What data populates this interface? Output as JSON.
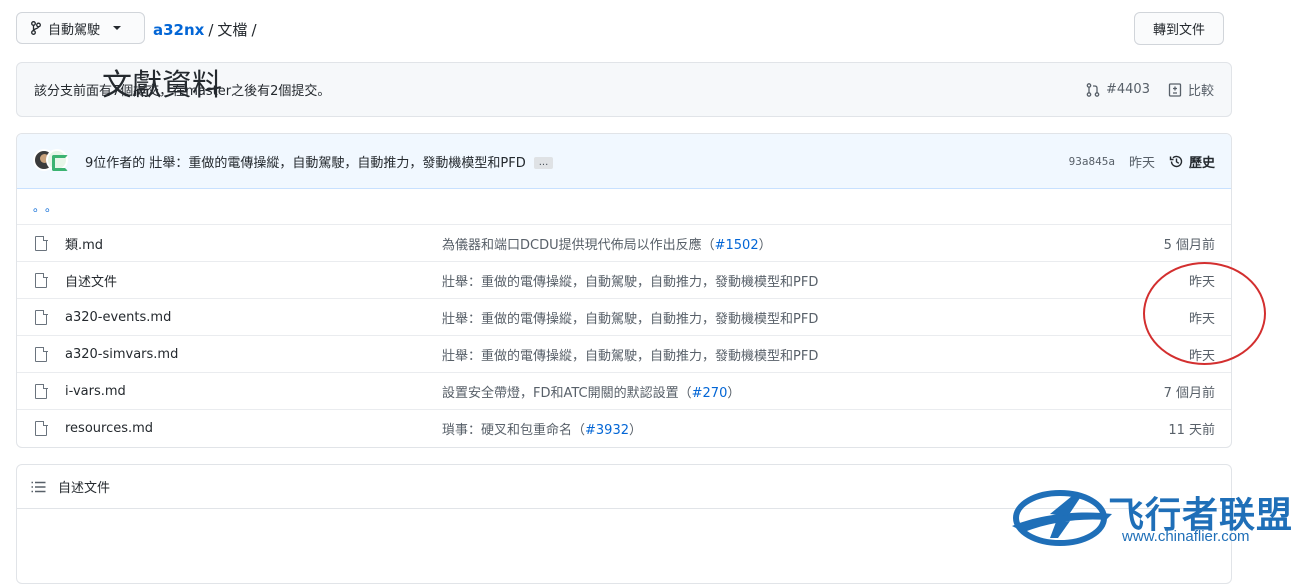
{
  "topbar": {
    "branch_label": "自動駕駛",
    "repo": "a32nx",
    "folder": "文檔",
    "goto_label": "轉到文件"
  },
  "ahead": {
    "message": "該分支前面有7個提交，在master之後有2個提交。",
    "pr_label": "#4403",
    "compare_label": "比較"
  },
  "commit": {
    "message": "9位作者的 壯舉：重做的電傳操縱，自動駕駛，自動推力，發動機模型和PFD",
    "ellipsis": "...",
    "sha": "93a845a",
    "time": "昨天",
    "history_label": "歷史"
  },
  "dots_row": "。。",
  "files": [
    {
      "name": "類.md",
      "msg": "為儀器和端口DCDU提供現代佈局以作出反應（",
      "pr": "#1502",
      "msg_end": "）",
      "age": "5 個月前"
    },
    {
      "name": "自述文件",
      "msg": "壯舉：重做的電傳操縱，自動駕駛，自動推力，發動機模型和PFD",
      "pr": "",
      "msg_end": "",
      "age": "昨天"
    },
    {
      "name": "a320-events.md",
      "msg": "壯舉：重做的電傳操縱，自動駕駛，自動推力，發動機模型和PFD",
      "pr": "",
      "msg_end": "",
      "age": "昨天"
    },
    {
      "name": "a320-simvars.md",
      "msg": "壯舉：重做的電傳操縱，自動駕駛，自動推力，發動機模型和PFD",
      "pr": "",
      "msg_end": "",
      "age": "昨天"
    },
    {
      "name": "i-vars.md",
      "msg": "設置安全帶燈，FD和ATC開關的默認設置（",
      "pr": "#270",
      "msg_end": "）",
      "age": "7 個月前"
    },
    {
      "name": "resources.md",
      "msg": "瑣事：硬叉和包重命名（",
      "pr": "#3932",
      "msg_end": "）",
      "age": "11 天前"
    }
  ],
  "readme": {
    "header_label": "自述文件",
    "title": "文獻資料"
  },
  "watermark": {
    "brand": "飞行者联盟",
    "url": "www.chinaflier.com"
  },
  "colors": {
    "link": "#0366d6",
    "annotation": "#d32f2f",
    "watermark": "#1f6fb8"
  }
}
